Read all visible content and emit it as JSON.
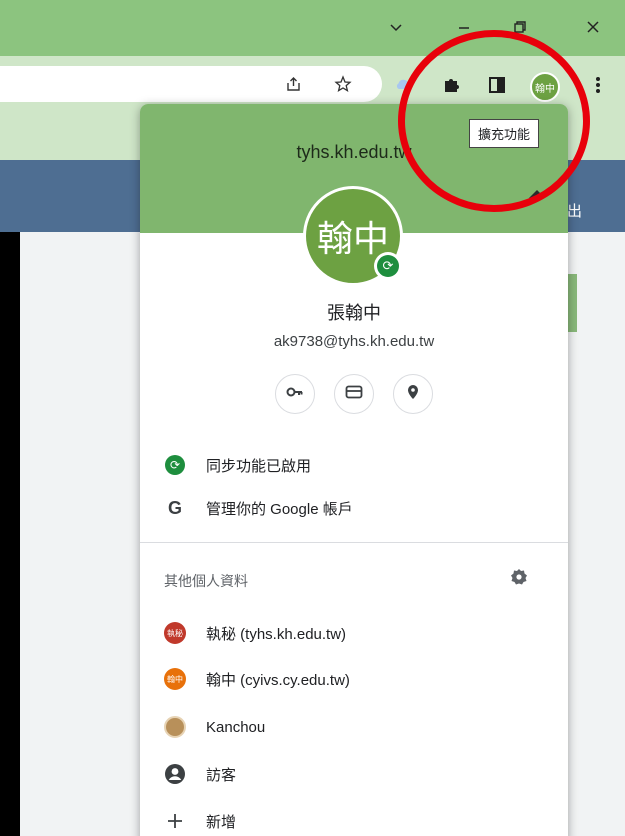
{
  "window": {
    "controls": [
      "chevron",
      "minimize",
      "restore",
      "close"
    ]
  },
  "toolbar": {
    "profile_chip": "翰中"
  },
  "page": {
    "header_text": "出"
  },
  "tooltip": {
    "text": "擴充功能"
  },
  "profile": {
    "domain": "tyhs.kh.edu.tw",
    "avatar_text": "翰中",
    "name": "張翰中",
    "email": "ak9738@tyhs.kh.edu.tw",
    "quick_actions": [
      "key-icon",
      "card-icon",
      "location-icon"
    ],
    "sync_label": "同步功能已啟用",
    "google_account_label": "管理你的 Google 帳戶",
    "google_glyph": "G"
  },
  "other_profiles": {
    "title": "其他個人資料",
    "items": [
      {
        "label": "執秘 (tyhs.kh.edu.tw)",
        "avatar": "執秘",
        "color": "#c0392b"
      },
      {
        "label": "翰中 (cyivs.cy.edu.tw)",
        "avatar": "翰中",
        "color": "#e8710a"
      },
      {
        "label": "Kanchou",
        "avatar": "",
        "color": "#b8905a"
      }
    ],
    "guest_label": "訪客",
    "add_label": "新增"
  },
  "colors": {
    "accent_green": "#80b66e",
    "sync_green": "#1e8e3e",
    "annotation_red": "#e8000b"
  }
}
